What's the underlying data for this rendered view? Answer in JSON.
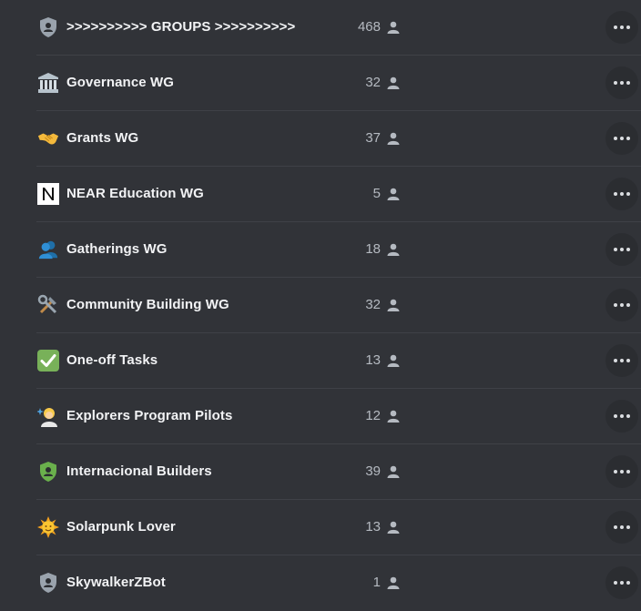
{
  "roles": [
    {
      "name": ">>>>>>>>>> GROUPS >>>>>>>>>>",
      "count": "468",
      "icon": "shield-person-icon",
      "icon_color": "#9aa3ad"
    },
    {
      "name": "Governance WG",
      "count": "32",
      "icon": "classical-building-icon",
      "glyph": "🏛"
    },
    {
      "name": "Grants WG",
      "count": "37",
      "icon": "handshake-icon",
      "glyph": "🤝"
    },
    {
      "name": "NEAR Education WG",
      "count": "5",
      "icon": "near-logo-icon"
    },
    {
      "name": "Gatherings WG",
      "count": "18",
      "icon": "busts-icon",
      "glyph": "👥"
    },
    {
      "name": "Community Building WG",
      "count": "32",
      "icon": "hammer-wrench-icon",
      "glyph": "🛠"
    },
    {
      "name": "One-off Tasks",
      "count": "13",
      "icon": "check-mark-icon",
      "glyph": "✓"
    },
    {
      "name": "Explorers Program Pilots",
      "count": "12",
      "icon": "explorer-person-icon",
      "glyph": "👩"
    },
    {
      "name": "Internacional Builders",
      "count": "39",
      "icon": "shield-person-icon",
      "icon_color": "#6ab04c"
    },
    {
      "name": "Solarpunk Lover",
      "count": "13",
      "icon": "sun-face-icon",
      "glyph": "☀"
    },
    {
      "name": "SkywalkerZBot",
      "count": "1",
      "icon": "shield-person-icon",
      "icon_color": "#9aa3ad"
    }
  ],
  "colors": {
    "background": "#313338",
    "divider": "#3f4147",
    "more_button": "#2b2d31"
  }
}
